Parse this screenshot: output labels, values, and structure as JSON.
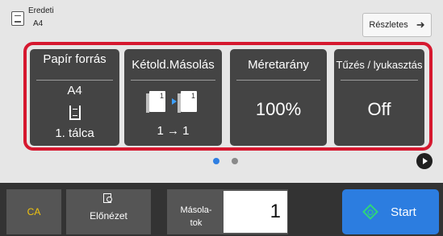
{
  "original": {
    "label": "Eredeti",
    "size": "A4"
  },
  "header": {
    "details_label": "Részletes",
    "details_arrow": "➜"
  },
  "panels": {
    "paper_source": {
      "title": "Papír forrás",
      "paper": "A4",
      "tray": "1. tálca"
    },
    "duplex": {
      "title": "Kétold.Másolás",
      "page_left": "1",
      "page_right": "1",
      "value": "1 → 1"
    },
    "ratio": {
      "title": "Méretarány",
      "value": "100%"
    },
    "staple": {
      "title": "Tűzés / lyukasztás",
      "value": "Off"
    }
  },
  "pagination": {
    "pages": 2,
    "current": 1
  },
  "bottom": {
    "ca_label": "CA",
    "preview_label": "Előnézet",
    "copies_label": "Másola-\ntok",
    "copies_value": "1",
    "start_label": "Start"
  },
  "colors": {
    "highlight": "#d6182f",
    "accent": "#2c7de0",
    "ca": "#f1c40f"
  }
}
